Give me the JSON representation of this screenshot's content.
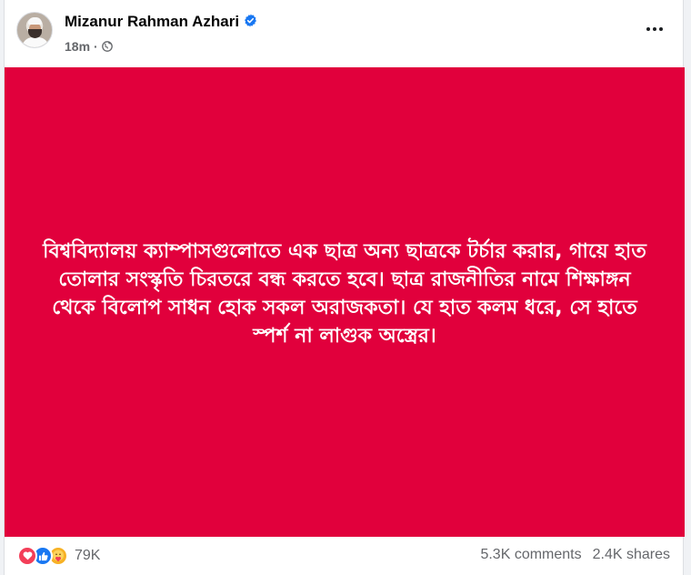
{
  "post": {
    "author": {
      "name": "Mizanur Rahman Azhari",
      "verified": true
    },
    "timestamp": "18m",
    "audience_icon": "globe-icon",
    "menu_icon": "more-options-icon",
    "image": {
      "background_color": "#e1003c",
      "text_lines": [
        "বিশ্ববিদ্যালয় ক্যাম্পাসগুলোতে এক ছাত্র অন্য ছাত্রকে টর্চার করার, গায়ে হাত",
        "তোলার সংস্কৃতি চিরতরে বন্ধ করতে হবে। ছাত্র রাজনীতির নামে শিক্ষাঙ্গন",
        "থেকে বিলোপ সাধন হোক সকল অরাজকতা। যে হাত কলম ধরে, সে হাতে",
        "স্পর্শ না লাগুক অস্ত্রের।"
      ]
    },
    "engagement": {
      "reaction_icons": [
        "love-icon",
        "like-icon",
        "care-icon"
      ],
      "reactions": "79K",
      "comments": "5.3K comments",
      "shares": "2.4K shares"
    }
  },
  "colors": {
    "verified_blue": "#1877f2",
    "meta_gray": "#65676b"
  }
}
